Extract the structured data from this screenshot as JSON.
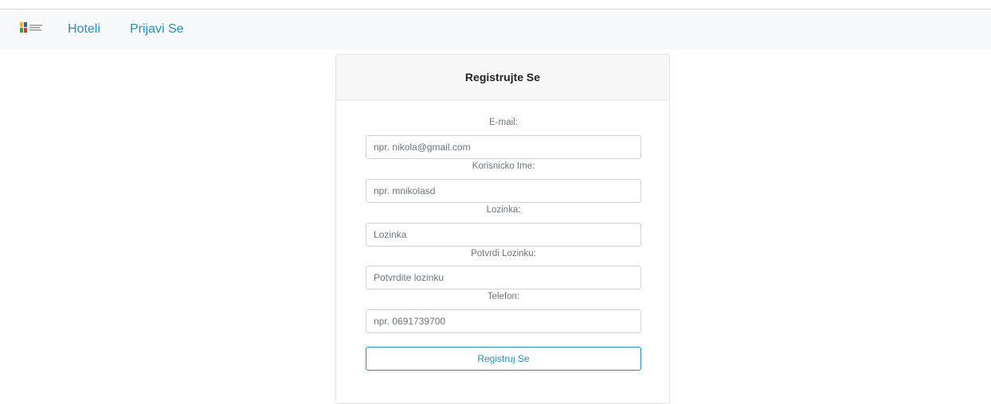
{
  "navbar": {
    "logo_icon": "hotel-logo-icon",
    "links": {
      "hoteli": "Hoteli",
      "prijavi_se": "Prijavi Se"
    },
    "link_color": "#2a8fbd"
  },
  "form": {
    "title": "Registrujte Se",
    "fields": {
      "email": {
        "label": "E-mail:",
        "placeholder": "npr. nikola@gmail.com"
      },
      "username": {
        "label": "Korisnicko Ime:",
        "placeholder": "npr. mnikolasd"
      },
      "password": {
        "label": "Lozinka:",
        "placeholder": "Lozinka"
      },
      "confirm_password": {
        "label": "Potvrdi Lozinku:",
        "placeholder": "Potvrdite lozinku"
      },
      "phone": {
        "label": "Telefon:",
        "placeholder": "npr. 0691739700"
      }
    },
    "submit_label": "Registruj Se"
  }
}
